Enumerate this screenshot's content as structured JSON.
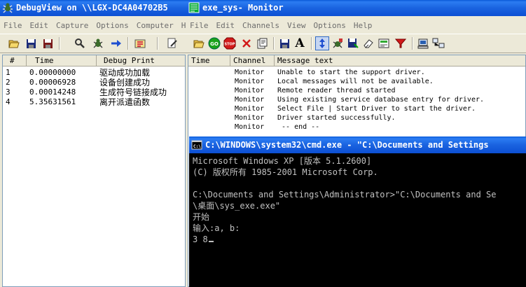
{
  "debugview": {
    "title": "DebugView on \\\\LGX-DC4A04702B5",
    "menu": [
      "File",
      "Edit",
      "Capture",
      "Options",
      "Computer",
      "He"
    ],
    "columns": [
      "#",
      "Time",
      "Debug Print"
    ],
    "rows": [
      {
        "num": "1",
        "time": "0.00000000",
        "text": "驱动成功加载"
      },
      {
        "num": "2",
        "time": "0.00006928",
        "text": "设备创建成功"
      },
      {
        "num": "3",
        "time": "0.00014248",
        "text": "生成符号链接成功"
      },
      {
        "num": "4",
        "time": "5.35631561",
        "text": "离开派遣函数"
      }
    ]
  },
  "monitor": {
    "title": "exe_sys- Monitor",
    "menu": [
      "File",
      "Edit",
      "Channels",
      "View",
      "Options",
      "Help"
    ],
    "columns": [
      "Time",
      "Channel",
      "Message text"
    ],
    "rows": [
      {
        "time": "",
        "channel": "Monitor",
        "text": "Unable to start the support driver."
      },
      {
        "time": "",
        "channel": "Monitor",
        "text": "Local messages will not be available."
      },
      {
        "time": "",
        "channel": "Monitor",
        "text": "Remote reader thread started"
      },
      {
        "time": "",
        "channel": "Monitor",
        "text": "Using existing service database entry for driver."
      },
      {
        "time": "",
        "channel": "Monitor",
        "text": "Select File | Start Driver to start the driver."
      },
      {
        "time": "",
        "channel": "Monitor",
        "text": "Driver started successfully."
      },
      {
        "time": "",
        "channel": "Monitor",
        "text": " -- end --"
      }
    ]
  },
  "cmd": {
    "title": "C:\\WINDOWS\\system32\\cmd.exe - \"C:\\Documents and Settings",
    "lines": [
      "Microsoft Windows XP [版本 5.1.2600]",
      "(C) 版权所有 1985-2001 Microsoft Corp.",
      "",
      "C:\\Documents and Settings\\Administrator>\"C:\\Documents and Se",
      "\\桌面\\sys_exe.exe\"",
      "开始",
      "输入:a, b:",
      "3 8"
    ]
  },
  "colors": {
    "titlebar": "#0c4fd3",
    "window_bg": "#ece9d8",
    "console_bg": "#000000",
    "console_fg": "#c0c0c0"
  }
}
